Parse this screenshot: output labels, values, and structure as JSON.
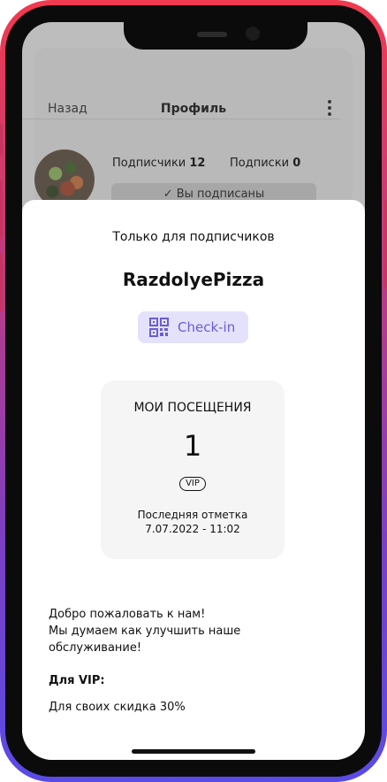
{
  "profile": {
    "back_label": "Назад",
    "title": "Профиль",
    "followers_label": "Подписчики",
    "followers_count": "12",
    "following_label": "Подписки",
    "following_count": "0",
    "subscribed_label": "✓ Вы подписаны"
  },
  "sheet": {
    "subtitle": "Только для подписчиков",
    "business_name": "RazdolyePizza",
    "checkin_label": "Check-in",
    "visits_title": "МОИ ПОСЕЩЕНИЯ",
    "visits_count": "1",
    "vip_badge": "VIP",
    "last_mark_label": "Последняя отметка",
    "last_mark_datetime": "7.07.2022 - 11:02",
    "welcome_text": "Добро пожаловать к нам!\nМы думаем как улучшить наше\nобслуживание!",
    "vip_heading": "Для VIP:",
    "vip_text": "Для своих скидка 30%"
  },
  "icons": {
    "more": "more-vertical-icon",
    "qr": "qr-code-icon"
  },
  "colors": {
    "accent": "#6b5bd8",
    "accent_bg": "#e4e2fb",
    "frame_top": "#f03a4f",
    "frame_bottom": "#5a4be6"
  }
}
